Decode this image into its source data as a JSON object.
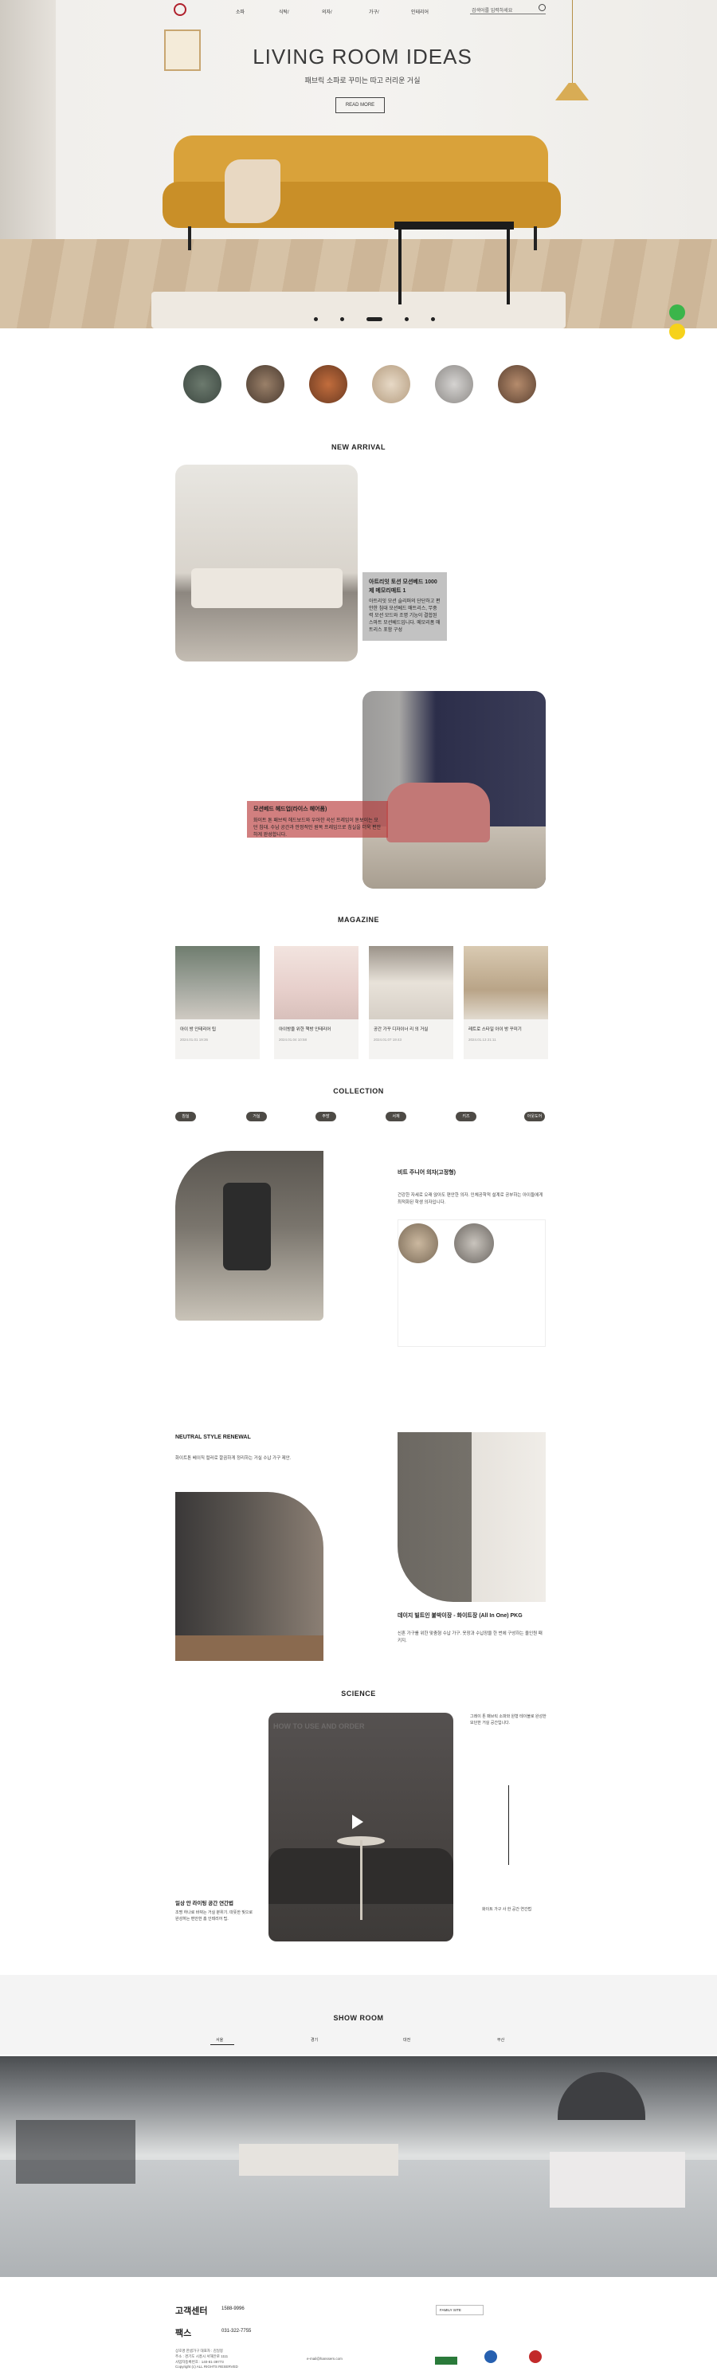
{
  "nav": {
    "items": [
      "소파",
      "식탁/",
      "의자/",
      "가구/",
      "인테리어"
    ],
    "search_placeholder": "검색어를 입력하세요"
  },
  "hero": {
    "title": "LIVING ROOM IDEAS",
    "subtitle": "패브릭 소파로 꾸미는 따고 러리운 거실",
    "button": "READ MORE"
  },
  "new_arrival": {
    "title": "NEW ARRIVAL",
    "item1": {
      "name": "아트리잇 토션 모션베드 1000제 메모리매트 1",
      "desc": "아트리잇 모션 슬리퍼의 단단하고 편안한 침대 모션베드 매트리스, 무중력 모션 모드와 조명 기능이 결합된 스마트 모션베드입니다. 메모리폼 매트리스 포함 구성"
    },
    "item2": {
      "name": "모션베드 헤드업(라이스 헤어폼)",
      "desc": "화이트 톤 패브릭 헤드보드와 우아한 곡선 프레임이 돋보이는 모던 침대. 수납 공간과 안정적인 원목 프레임으로 침실을 더욱 편안하게 완성합니다."
    }
  },
  "magazine": {
    "title": "MAGAZINE",
    "items": [
      {
        "title": "아이 방 인테리어 팁",
        "date": "2024.01.01 19:36"
      },
      {
        "title": "아이방을 위한 책방 인테리어",
        "date": "2024.01.04 10:58"
      },
      {
        "title": "공간 가꾸 디자이너 리 의 거실",
        "date": "2024.01.07 19:43"
      },
      {
        "title": "레트로 스타일 아이 방 꾸미기",
        "date": "2024.01.13 21:11"
      }
    ]
  },
  "collection": {
    "title": "COLLECTION",
    "tabs": [
      "침실",
      "거실",
      "주방",
      "서재",
      "키즈",
      "아웃도어"
    ],
    "product": {
      "name": "비트 주니어 의자(고정형)",
      "desc": "건강한 자세로 오래 앉아도 편안한 의자. 인체공학적 설계로 공부하는 아이들에게 최적화된 학생 의자입니다."
    }
  },
  "neutral": {
    "title": "NEUTRAL STYLE RENEWAL",
    "desc": "화이트톤 베이직 컬러로 깔끔하게 정리하는 거실 수납 가구 제안.",
    "product_name": "데이지 빌트인 붙박이장 - 화이트장 (All In One) PKG",
    "product_desc": "신혼 가구를 위한 맞춤형 수납 가구. 옷장과 수납장을 한 번에 구성하는 올인원 패키지."
  },
  "science": {
    "title": "SCIENCE",
    "video_title": "HOW TO USE AND ORDER",
    "left_title": "일상 안 라이팅 공간 연간법",
    "left_desc": "조명 하나로 바뀌는 거실 분위기. 따뜻한 빛으로 완성하는 편안한 홈 인테리어 팁.",
    "right_desc": "그레이 톤 패브릭 소파와 원형 테이블로 완성한 모던한 거실 공간입니다.",
    "right_caption": "화이트 가구 사 한 공간 연간법"
  },
  "showroom": {
    "title": "SHOW ROOM",
    "tabs": [
      "서울",
      "경기",
      "대전",
      "부산"
    ]
  },
  "footer": {
    "cs_title": "고객센터",
    "cs_phone": "1588-9996",
    "fax_label": "팩스",
    "fax_number": "031-322-7755",
    "family_site": "FAMILY SITE",
    "address_lines": [
      "상호명 한샘가구 대표자 : 김일봉",
      "주소 : 경기도 시흥시 서해안로 1111",
      "사업자등록번호 : 140-81-39773",
      "Copyright (c) ALL RIGHTS RESERVED"
    ],
    "email": "e-mail@hanssem.com"
  },
  "colors": {
    "accent": "#b0202c",
    "sofa": "#c98f28",
    "pill": "#4d4a45",
    "overlay_gray": "#8f8f8f",
    "overlay_red": "#b83a3a"
  }
}
